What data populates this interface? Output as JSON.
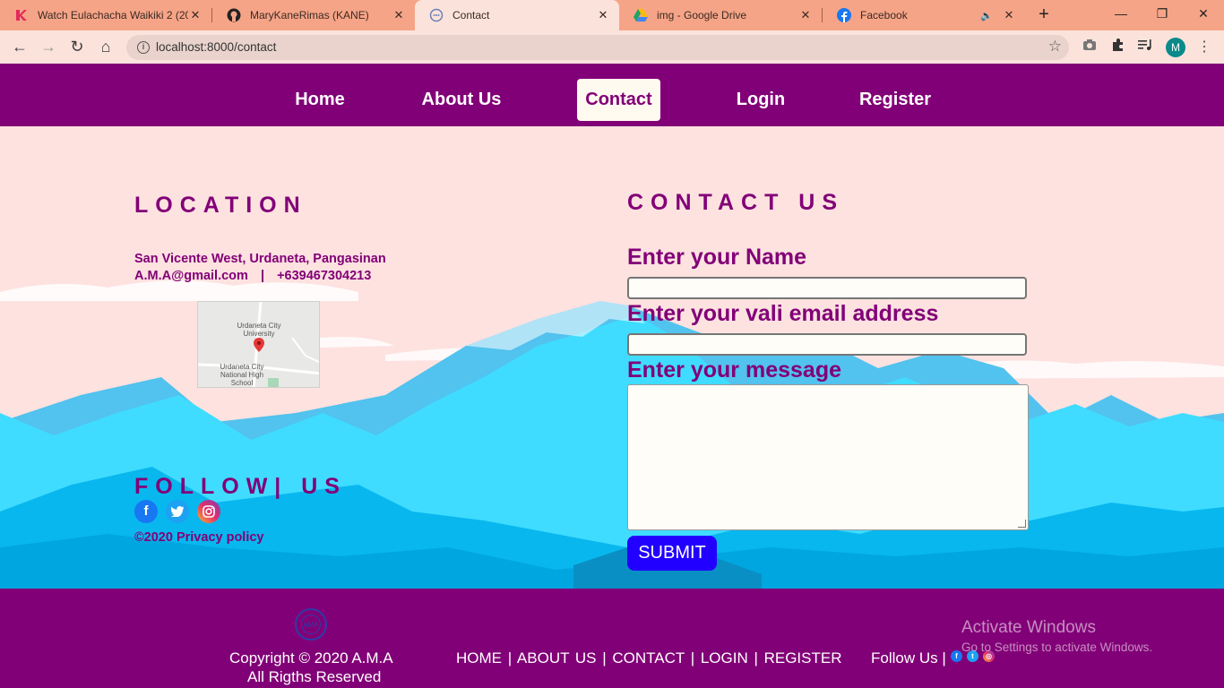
{
  "browser": {
    "tabs": [
      {
        "title": "Watch Eulachacha Waikiki 2 (20",
        "icon": "kissasian-icon",
        "close": "✕"
      },
      {
        "title": "MaryKaneRimas (KANE)",
        "icon": "github-icon",
        "close": "✕"
      },
      {
        "title": "Contact",
        "icon": "page-icon",
        "close": "✕"
      },
      {
        "title": "img - Google Drive",
        "icon": "google-drive-icon",
        "close": "✕"
      },
      {
        "title": "Facebook",
        "icon": "facebook-icon",
        "close": "✕"
      }
    ],
    "new_tab": "+",
    "url": "localhost:8000/contact",
    "avatar_letter": "M",
    "window_controls": {
      "minimize": "—",
      "restore": "❐",
      "close": "✕"
    },
    "nav_glyphs": {
      "back": "←",
      "forward": "→",
      "reload": "↻",
      "home": "⌂",
      "star": "☆",
      "info": "i",
      "menu": "⋮"
    }
  },
  "nav": {
    "items": [
      "Home",
      "About Us",
      "Contact",
      "Login",
      "Register"
    ],
    "active": "Contact"
  },
  "location": {
    "title": "LOCATION",
    "address": "San Vicente West, Urdaneta, Pangasinan",
    "email": "A.M.A@gmail.com",
    "separator": "|",
    "phone": "+639467304213",
    "map_labels": {
      "top": "Urdaneta City University",
      "bottom": "Urdaneta City National High School"
    }
  },
  "follow": {
    "title": "FOLLOW| US",
    "copyright": "©2020 Privacy policy",
    "icons": [
      "facebook-icon",
      "twitter-icon",
      "instagram-icon"
    ]
  },
  "contact": {
    "title": "CONTACT US",
    "name_label": "Enter your Name",
    "email_label": "Enter your vali email address",
    "message_label": "Enter your message",
    "name_value": "",
    "email_value": "",
    "message_value": "",
    "submit": "SUBMIT"
  },
  "footer": {
    "copyright_line1": "Copyright © 2020 A.M.A",
    "copyright_line2": "All Rigths Reserved",
    "links": "HOME | ABOUT US | CONTACT | LOGIN | REGISTER",
    "follow": "Follow Us |",
    "logo_text": "AMA"
  },
  "watermark": {
    "title": "Activate Windows",
    "subtitle": "Go to Settings to activate Windows."
  },
  "colors": {
    "brand": "#820077",
    "page_bg": "#fde2e0",
    "submit": "#2200ff",
    "tab_strip": "#f6a487"
  }
}
